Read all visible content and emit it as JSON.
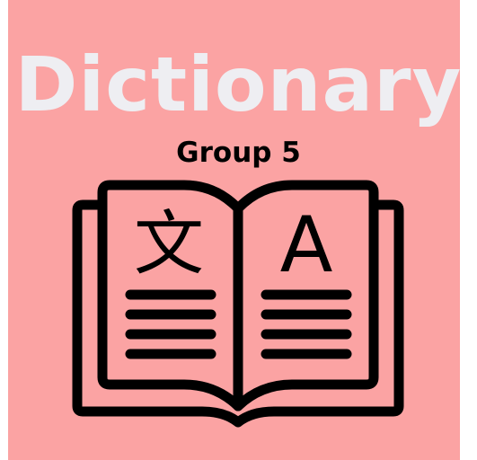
{
  "title": "Dictionary",
  "subtitle": "Group 5",
  "book": {
    "left_glyph": "文",
    "right_glyph": "A",
    "icon": "open-book-icon"
  },
  "colors": {
    "background": "#fba3a3",
    "title": "#eeeef2",
    "ink": "#000000"
  }
}
